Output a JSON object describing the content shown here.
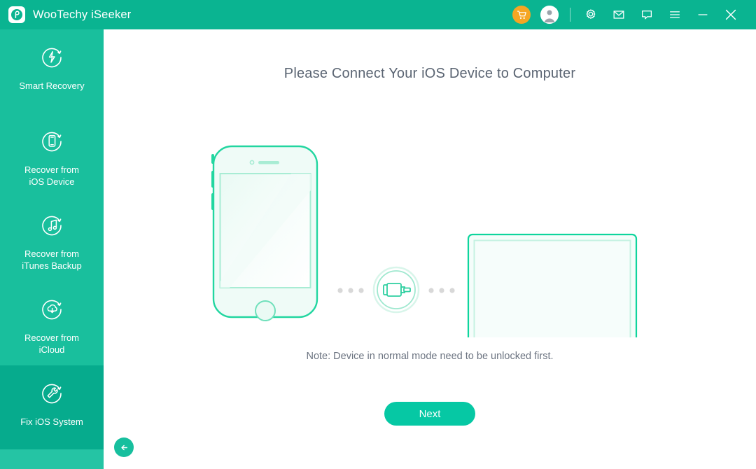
{
  "window": {
    "app_title": "WooTechy iSeeker",
    "logo_icon": "wootechy-logo-icon",
    "titlebar_color": "#0ab491",
    "accent_color": "#06c8a4",
    "cart_badge_color": "#f5a623",
    "controls": [
      {
        "name": "cart-icon",
        "label": "Cart"
      },
      {
        "name": "account-icon",
        "label": "Account"
      },
      {
        "name": "settings-gear-icon",
        "label": "Settings"
      },
      {
        "name": "mail-icon",
        "label": "Mail"
      },
      {
        "name": "feedback-chat-icon",
        "label": "Feedback"
      },
      {
        "name": "menu-hamburger-icon",
        "label": "Menu"
      },
      {
        "name": "minimize-icon",
        "label": "Minimize"
      },
      {
        "name": "close-icon",
        "label": "Close"
      }
    ]
  },
  "sidebar": {
    "background": "#19bf9d",
    "active_background": "#06ab8d",
    "items": [
      {
        "label": "Smart Recovery",
        "icon": "smart-recovery-icon",
        "active": false
      },
      {
        "label": "Recover from\niOS Device",
        "icon": "recover-ios-device-icon",
        "active": false
      },
      {
        "label": "Recover from\niTunes Backup",
        "icon": "recover-itunes-backup-icon",
        "active": false
      },
      {
        "label": "Recover from\niCloud",
        "icon": "recover-icloud-icon",
        "active": false
      },
      {
        "label": "Fix iOS System",
        "icon": "fix-ios-system-icon",
        "active": true
      }
    ]
  },
  "main": {
    "headline": "Please Connect Your iOS Device to Computer",
    "note": "Note: Device in normal mode need to be unlocked first.",
    "next_label": "Next",
    "back_label": "Back",
    "illustration": {
      "phone": "iphone-outline-illustration",
      "connector": "usb-connector-icon",
      "laptop": "laptop-outline-illustration",
      "stroke_color": "#22d6a0",
      "dot_color": "#d8d8d8"
    }
  }
}
